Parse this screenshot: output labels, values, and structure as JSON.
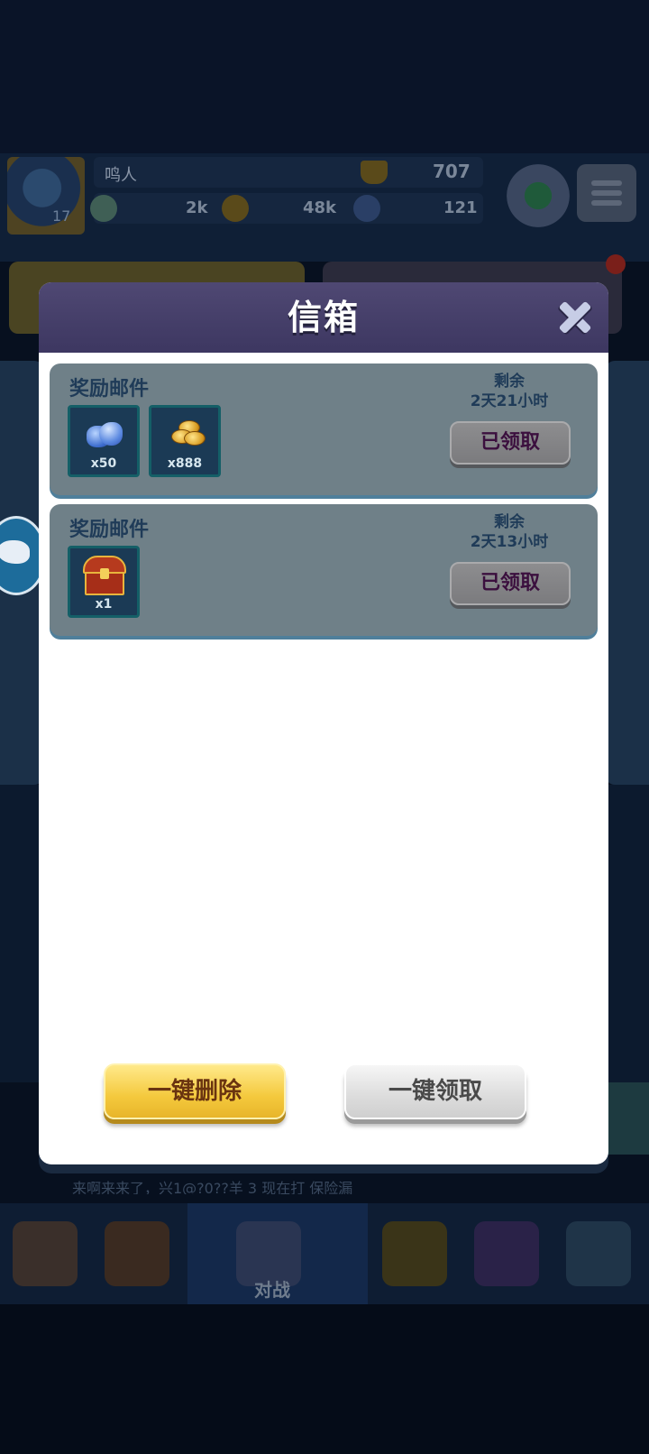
{
  "background": {
    "player": {
      "name": "鸣人",
      "level": "17"
    },
    "stats": {
      "trophies": "707",
      "res1": "2k",
      "res2": "48k",
      "res3": "121"
    },
    "ticker": "来啊来来了，兴1@?0??羊  3  现在打  保险漏",
    "nav_active_label": "对战"
  },
  "modal": {
    "title": "信箱",
    "mails": [
      {
        "title": "奖励邮件",
        "remain_label": "剩余",
        "remain_time": "2天21小时",
        "status": "已领取",
        "rewards": [
          {
            "icon": "gem-icon",
            "qty": "x50"
          },
          {
            "icon": "coin-icon",
            "qty": "x888"
          }
        ]
      },
      {
        "title": "奖励邮件",
        "remain_label": "剩余",
        "remain_time": "2天13小时",
        "status": "已领取",
        "rewards": [
          {
            "icon": "chest-icon",
            "qty": "x1"
          }
        ]
      }
    ],
    "delete_all_label": "一键删除",
    "claim_all_label": "一键领取"
  },
  "colors": {
    "modal_header": "#4f4873",
    "card": "#6f8088",
    "delete_button": "#f4c93d",
    "claim_button": "#dcdcdc"
  }
}
